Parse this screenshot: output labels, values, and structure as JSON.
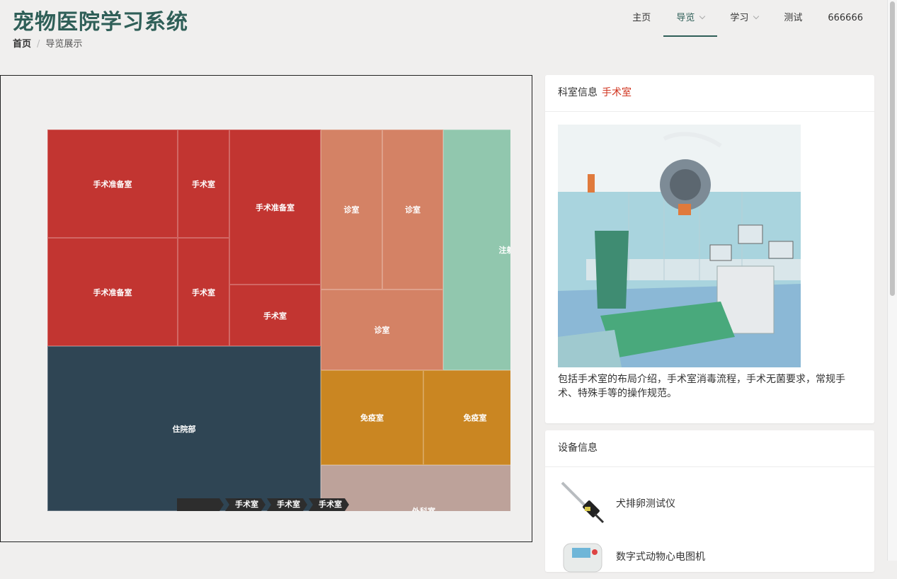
{
  "app": {
    "title": "宠物医院学习系统"
  },
  "breadcrumb": {
    "home": "首页",
    "separator": "/",
    "current": "导览展示"
  },
  "nav": {
    "items": [
      {
        "label": "主页"
      },
      {
        "label": "导览",
        "has_dropdown": true,
        "active": true
      },
      {
        "label": "学习",
        "has_dropdown": true
      },
      {
        "label": "测试"
      },
      {
        "label": "666666"
      }
    ]
  },
  "treemap": {
    "cells": [
      {
        "label": "手术准备室",
        "color": "#c23531"
      },
      {
        "label": "手术室",
        "color": "#c23531"
      },
      {
        "label": "手术准备室",
        "color": "#c23531"
      },
      {
        "label": "手术准备室",
        "color": "#c23531"
      },
      {
        "label": "手术室",
        "color": "#c23531"
      },
      {
        "label": "手术室",
        "color": "#c23531"
      },
      {
        "label": "诊室",
        "color": "#d48265"
      },
      {
        "label": "诊室",
        "color": "#d48265"
      },
      {
        "label": "诊室",
        "color": "#d48265"
      },
      {
        "label": "注射室",
        "color": "#91c7ae"
      },
      {
        "label": "住院部",
        "color": "#2f4554"
      },
      {
        "label": "免疫室",
        "color": "#ca8622"
      },
      {
        "label": "免疫室",
        "color": "#ca8622"
      },
      {
        "label": "外科室",
        "color": "#bda29a"
      }
    ],
    "path": [
      "",
      "手术室",
      "手术室",
      "手术室"
    ]
  },
  "room_info": {
    "heading": "科室信息",
    "room_name": "手术室",
    "description": "包括手术室的布局介绍，手术室消毒流程，手术无菌要求，常规手术、特殊手等的操作规范。"
  },
  "device_info": {
    "heading": "设备信息",
    "devices": [
      {
        "name": "犬排卵测试仪",
        "icon": "ovulation-tester-icon"
      },
      {
        "name": "数字式动物心电图机",
        "icon": "ecg-machine-icon"
      }
    ]
  }
}
